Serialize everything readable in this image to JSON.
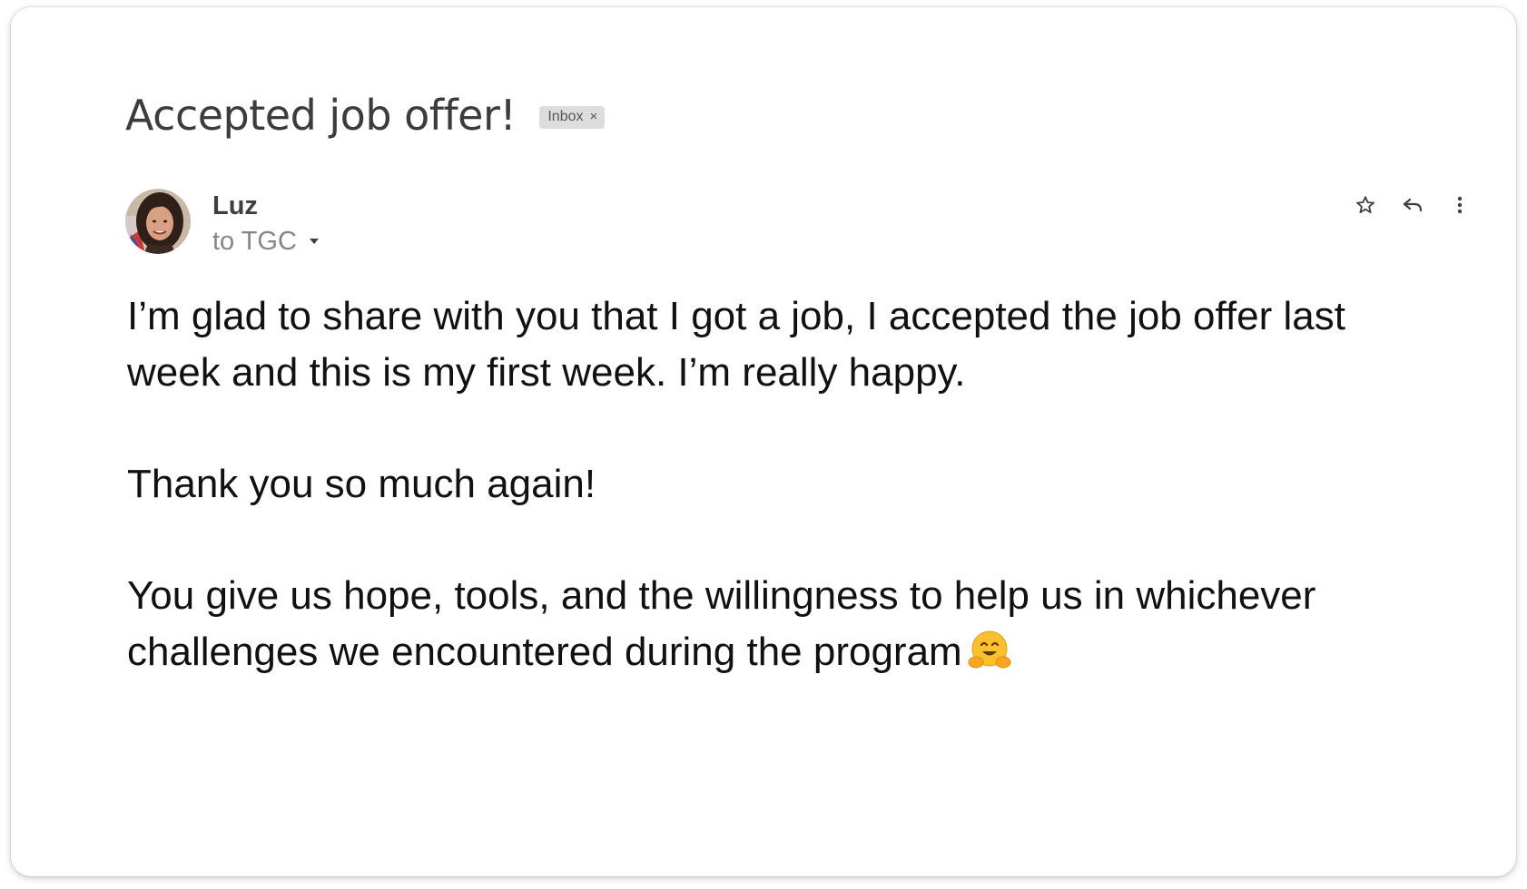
{
  "email": {
    "subject": "Accepted job offer!",
    "label": {
      "text": "Inbox",
      "remove_glyph": "×"
    },
    "sender": {
      "name": "Luz",
      "avatar_icon": "sender-avatar-photo"
    },
    "recipients": "to TGC",
    "actions": [
      {
        "name": "star",
        "icon": "star-outline-icon"
      },
      {
        "name": "reply",
        "icon": "reply-arrow-icon"
      },
      {
        "name": "more",
        "icon": "vertical-dots-icon"
      }
    ],
    "body": {
      "paragraph_1": "I’m glad to share with you that I got a job, I accepted the job offer last week and this is my first week. I’m really happy.",
      "paragraph_2": "Thank you so much again!",
      "paragraph_3": "You give us hope, tools, and the willingness to help us in whichever challenges we encountered during the program",
      "emoji": "hugging-face-emoji"
    }
  },
  "colors": {
    "subject": "#3c3c3c",
    "label_bg": "#dddddd",
    "sender_name": "#3c4043",
    "recipients": "#80868b",
    "body_text": "#111111",
    "emoji_yellow": "#fbc02d"
  }
}
